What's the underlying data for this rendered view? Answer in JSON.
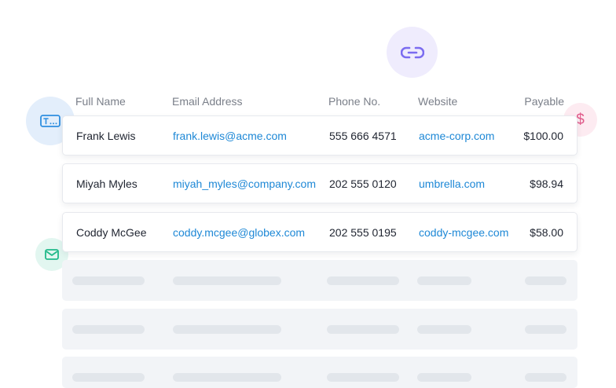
{
  "table": {
    "headers": {
      "name": "Full Name",
      "email": "Email Address",
      "phone": "Phone No.",
      "website": "Website",
      "payable": "Payable"
    },
    "rows": [
      {
        "name": "Frank Lewis",
        "email": "frank.lewis@acme.com",
        "phone": "555 666 4571",
        "website": "acme-corp.com",
        "payable": "$100.00"
      },
      {
        "name": "Miyah Myles",
        "email": "miyah_myles@company.com",
        "phone": "202 555 0120",
        "website": "umbrella.com",
        "payable": "$98.94"
      },
      {
        "name": "Coddy McGee",
        "email": "coddy.mcgee@globex.com",
        "phone": "202 555 0195",
        "website": "coddy-mcgee.com",
        "payable": "$58.00"
      }
    ],
    "placeholder_rows": 3
  },
  "icons": {
    "link": "link-icon",
    "text_field": "text-field-icon",
    "currency": "dollar-icon",
    "currency_glyph": "$",
    "mail": "mail-icon"
  },
  "colors": {
    "link_text": "#1e88d6",
    "link_icon": "#7b6cf0",
    "text_icon": "#2f8fe0",
    "dollar_icon": "#e05a8a",
    "mail_icon": "#21b98a"
  }
}
